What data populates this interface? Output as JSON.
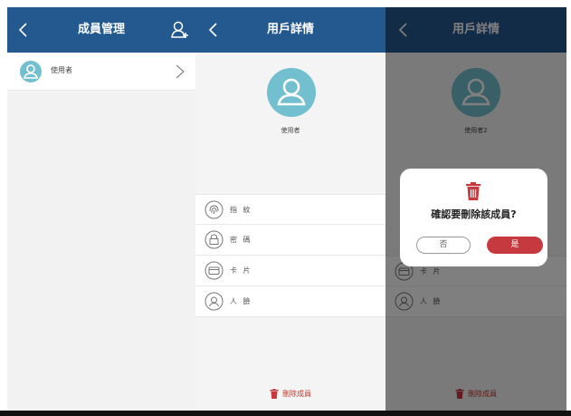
{
  "member_screen": {
    "title": "成員管理",
    "member_name": "使用者"
  },
  "detail_screen": {
    "title": "用戶詳情",
    "user_name": "使用者",
    "credentials": [
      {
        "label": "指 紋",
        "icon": "fingerprint-icon"
      },
      {
        "label": "密 碼",
        "icon": "password-icon"
      },
      {
        "label": "卡 片",
        "icon": "card-icon"
      },
      {
        "label": "人 臉",
        "icon": "face-icon"
      }
    ],
    "delete_label": "刪除成員"
  },
  "confirm_screen": {
    "title": "用戶詳情",
    "user_name": "使用者2",
    "credentials": [
      {
        "label": "卡 片",
        "icon": "card-icon"
      },
      {
        "label": "人 臉",
        "icon": "face-icon"
      }
    ],
    "delete_label": "刪除成員",
    "dialog": {
      "message": "確認要刪除該成員?",
      "no_label": "否",
      "yes_label": "是"
    }
  },
  "colors": {
    "header": "#24598f",
    "avatar": "#72bfcf",
    "danger": "#c63a3f"
  }
}
